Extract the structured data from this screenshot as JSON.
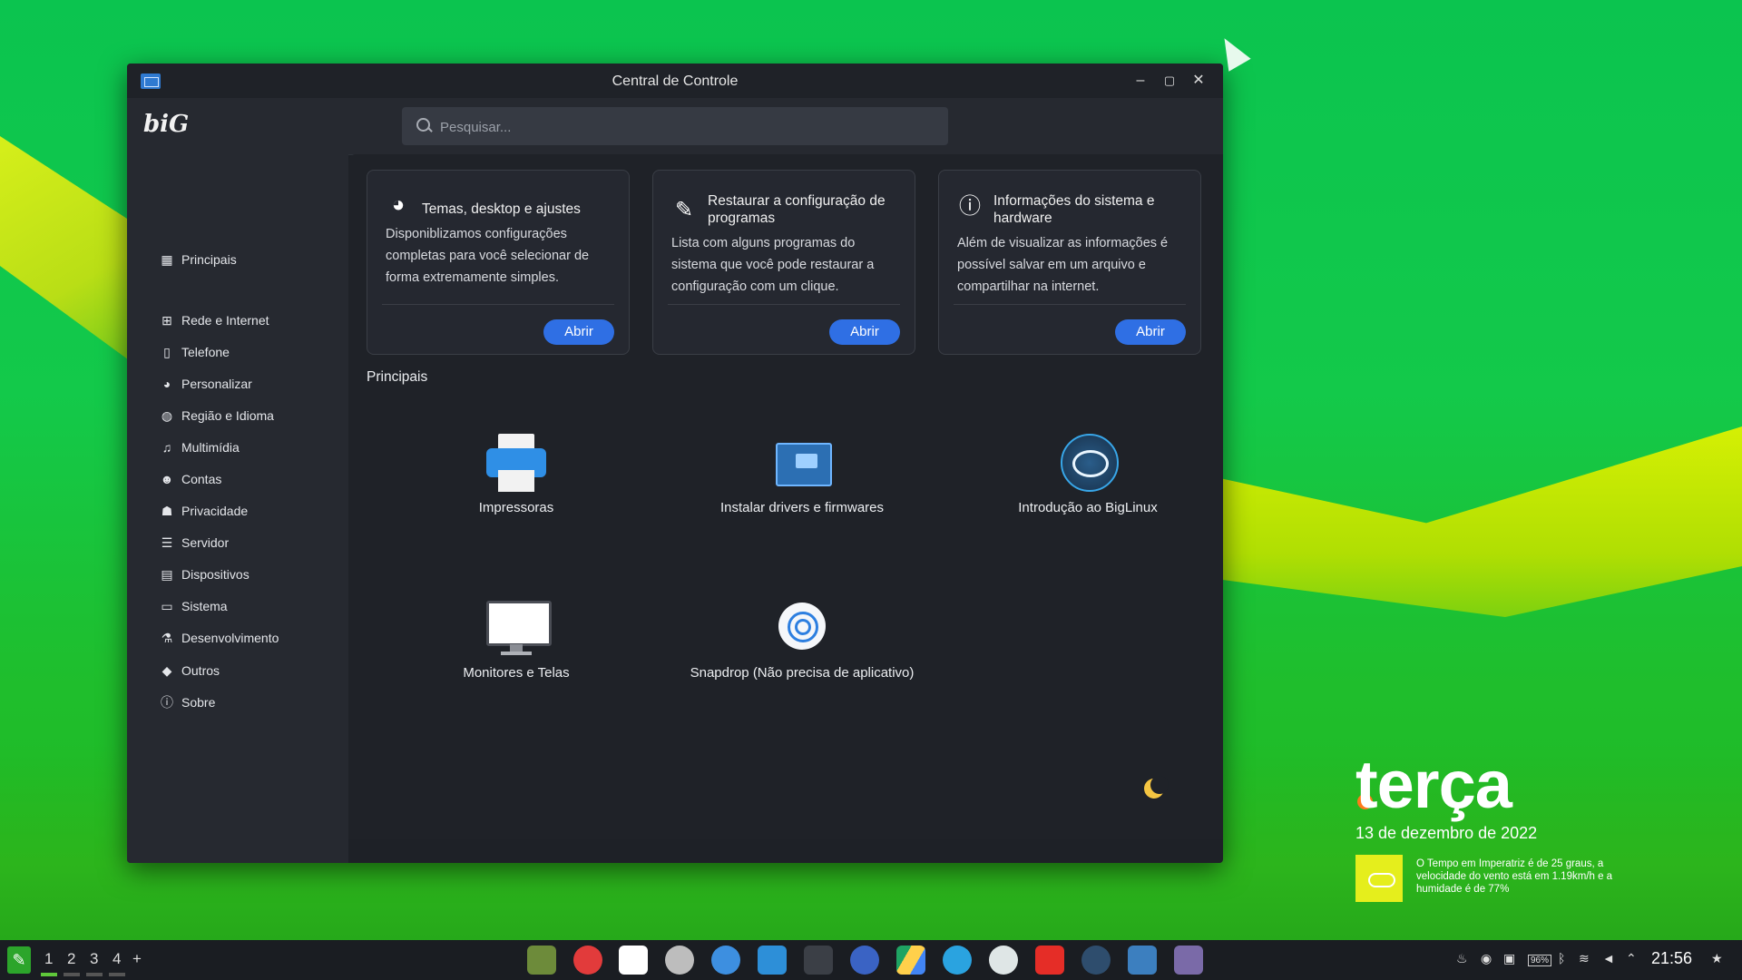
{
  "window": {
    "title": "Central de Controle",
    "min_label": "–",
    "max_label": "▢",
    "close_label": "✕"
  },
  "header": {
    "logo": "biG",
    "search_placeholder": "Pesquisar..."
  },
  "sidebar": {
    "items": [
      {
        "label": "Principais",
        "icon": "grid-icon"
      },
      {
        "label": "Rede e Internet",
        "icon": "network-icon"
      },
      {
        "label": "Telefone",
        "icon": "phone-icon"
      },
      {
        "label": "Personalizar",
        "icon": "palette-icon"
      },
      {
        "label": "Região e Idioma",
        "icon": "globe-icon"
      },
      {
        "label": "Multimídia",
        "icon": "music-icon"
      },
      {
        "label": "Contas",
        "icon": "users-icon"
      },
      {
        "label": "Privacidade",
        "icon": "user-lock-icon"
      },
      {
        "label": "Servidor",
        "icon": "server-icon"
      },
      {
        "label": "Dispositivos",
        "icon": "chip-icon"
      },
      {
        "label": "Sistema",
        "icon": "monitor-icon"
      },
      {
        "label": "Desenvolvimento",
        "icon": "flask-icon"
      },
      {
        "label": "Outros",
        "icon": "gem-icon"
      },
      {
        "label": "Sobre",
        "icon": "info-icon"
      }
    ]
  },
  "cards": [
    {
      "title": "Temas, desktop e ajustes",
      "desc": "Disponiblizamos configurações completas para você selecionar de forma extremamente simples.",
      "button": "Abrir",
      "icon": "palette-icon"
    },
    {
      "title": "Restaurar a configuração de programas",
      "desc": "Lista com alguns programas do sistema que você pode restaurar a configuração com um clique.",
      "button": "Abrir",
      "icon": "broom-icon"
    },
    {
      "title": "Informações do sistema e hardware",
      "desc": "Além de visualizar as informações é possível salvar em um arquivo e compartilhar na internet.",
      "button": "Abrir",
      "icon": "info-icon"
    }
  ],
  "section_title": "Principais",
  "apps": [
    {
      "label": "Impressoras"
    },
    {
      "label": "Instalar drivers e firmwares"
    },
    {
      "label": "Introdução ao BigLinux"
    },
    {
      "label": "Monitores e Telas"
    },
    {
      "label": "Snapdrop (Não precisa de aplicativo)"
    }
  ],
  "desktop_widget": {
    "day": "terça",
    "date": "13 de dezembro de 2022",
    "weather": "O Tempo em Imperatriz é de 25 graus, a velocidade do vento está em 1.19km/h e a humidade é de 77%"
  },
  "taskbar": {
    "workspaces": [
      "1",
      "2",
      "3",
      "4",
      "+"
    ],
    "apps": [
      "file-manager-icon",
      "vivaldi-icon",
      "gmail-icon",
      "whatsapp-icon",
      "kde-connect-icon",
      "vscode-icon",
      "terminal-icon",
      "browser-icon",
      "google-drive-icon",
      "telegram-icon",
      "settings-icon",
      "youtube-icon",
      "biglinux-icon",
      "control-center-icon",
      "screenshot-icon"
    ],
    "battery": "96%",
    "clock": "21:56"
  }
}
